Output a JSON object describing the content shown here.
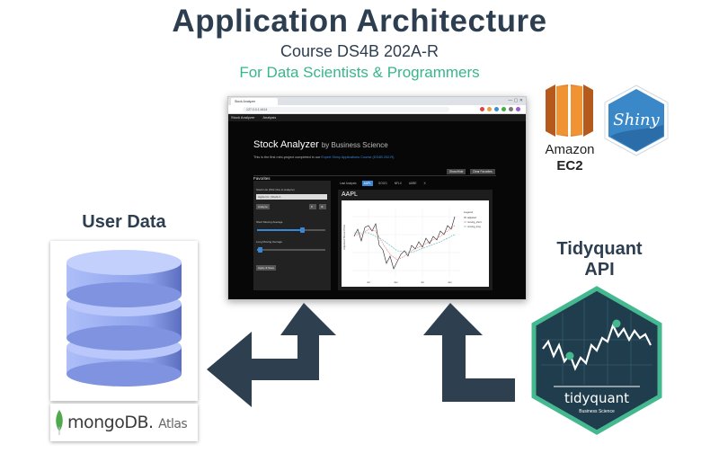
{
  "header": {
    "title": "Application Architecture",
    "subtitle": "Course DS4B 202A-R",
    "tagline": "For Data Scientists & Programmers"
  },
  "browser": {
    "tab_title": "Stock Analyzer",
    "url": "127.0.0.1:4414",
    "nav_items": [
      "Stock Analyzer",
      "Analysis"
    ],
    "app_title": "Stock Analyzer",
    "app_byline": "by Business Science",
    "description_prefix": "This is the first mini-project completed in our ",
    "description_link": "Expert Shiny Applications Course (DS4B 202-R)",
    "favorites_label": "Favorites",
    "show_hide_button": "Show/Hide",
    "clear_favorites_button": "Clear Favorites",
    "sidebar": {
      "stock_list_label": "Stock List (Pick One to Analyze)",
      "stock_selected": "Apple Inc. (Stock A",
      "analyze_button": "Analyze",
      "short_ma_label": "Short Moving Average",
      "long_ma_label": "Long Moving Average",
      "apply_button": "Apply & Save"
    },
    "tabs": [
      "Last Analysis",
      "AAPL",
      "GOOG",
      "NFLX",
      "ADBE",
      "X"
    ],
    "active_tab": "AAPL",
    "panel_title": "AAPL",
    "plot": {
      "ylabel": "Adjusted Share Price",
      "legend_title": "Legend",
      "legend_items": [
        "adjusted",
        "moving_short",
        "moving_long"
      ],
      "x_ticks": [
        "Jul",
        "Jan",
        "Jul",
        "Jan"
      ]
    }
  },
  "aws": {
    "line1": "Amazon",
    "line2": "EC2"
  },
  "shiny": {
    "label": "Shiny"
  },
  "user_data": {
    "label": "User Data"
  },
  "mongo": {
    "brand": "mongoDB.",
    "suffix": "Atlas"
  },
  "tidyquant": {
    "title_line1": "Tidyquant",
    "title_line2": "API",
    "logo_name": "tidyquant",
    "logo_sub": "Business Science"
  },
  "colors": {
    "title": "#2c3e50",
    "tagline": "#38b58e",
    "arrow": "#2e3f50",
    "aws_orange": "#e8802a",
    "shiny_blue": "#3b88c8",
    "tidyquant_dark": "#1f3d4c",
    "tidyquant_green": "#44b88f",
    "db_blue": "#9aaef0"
  }
}
